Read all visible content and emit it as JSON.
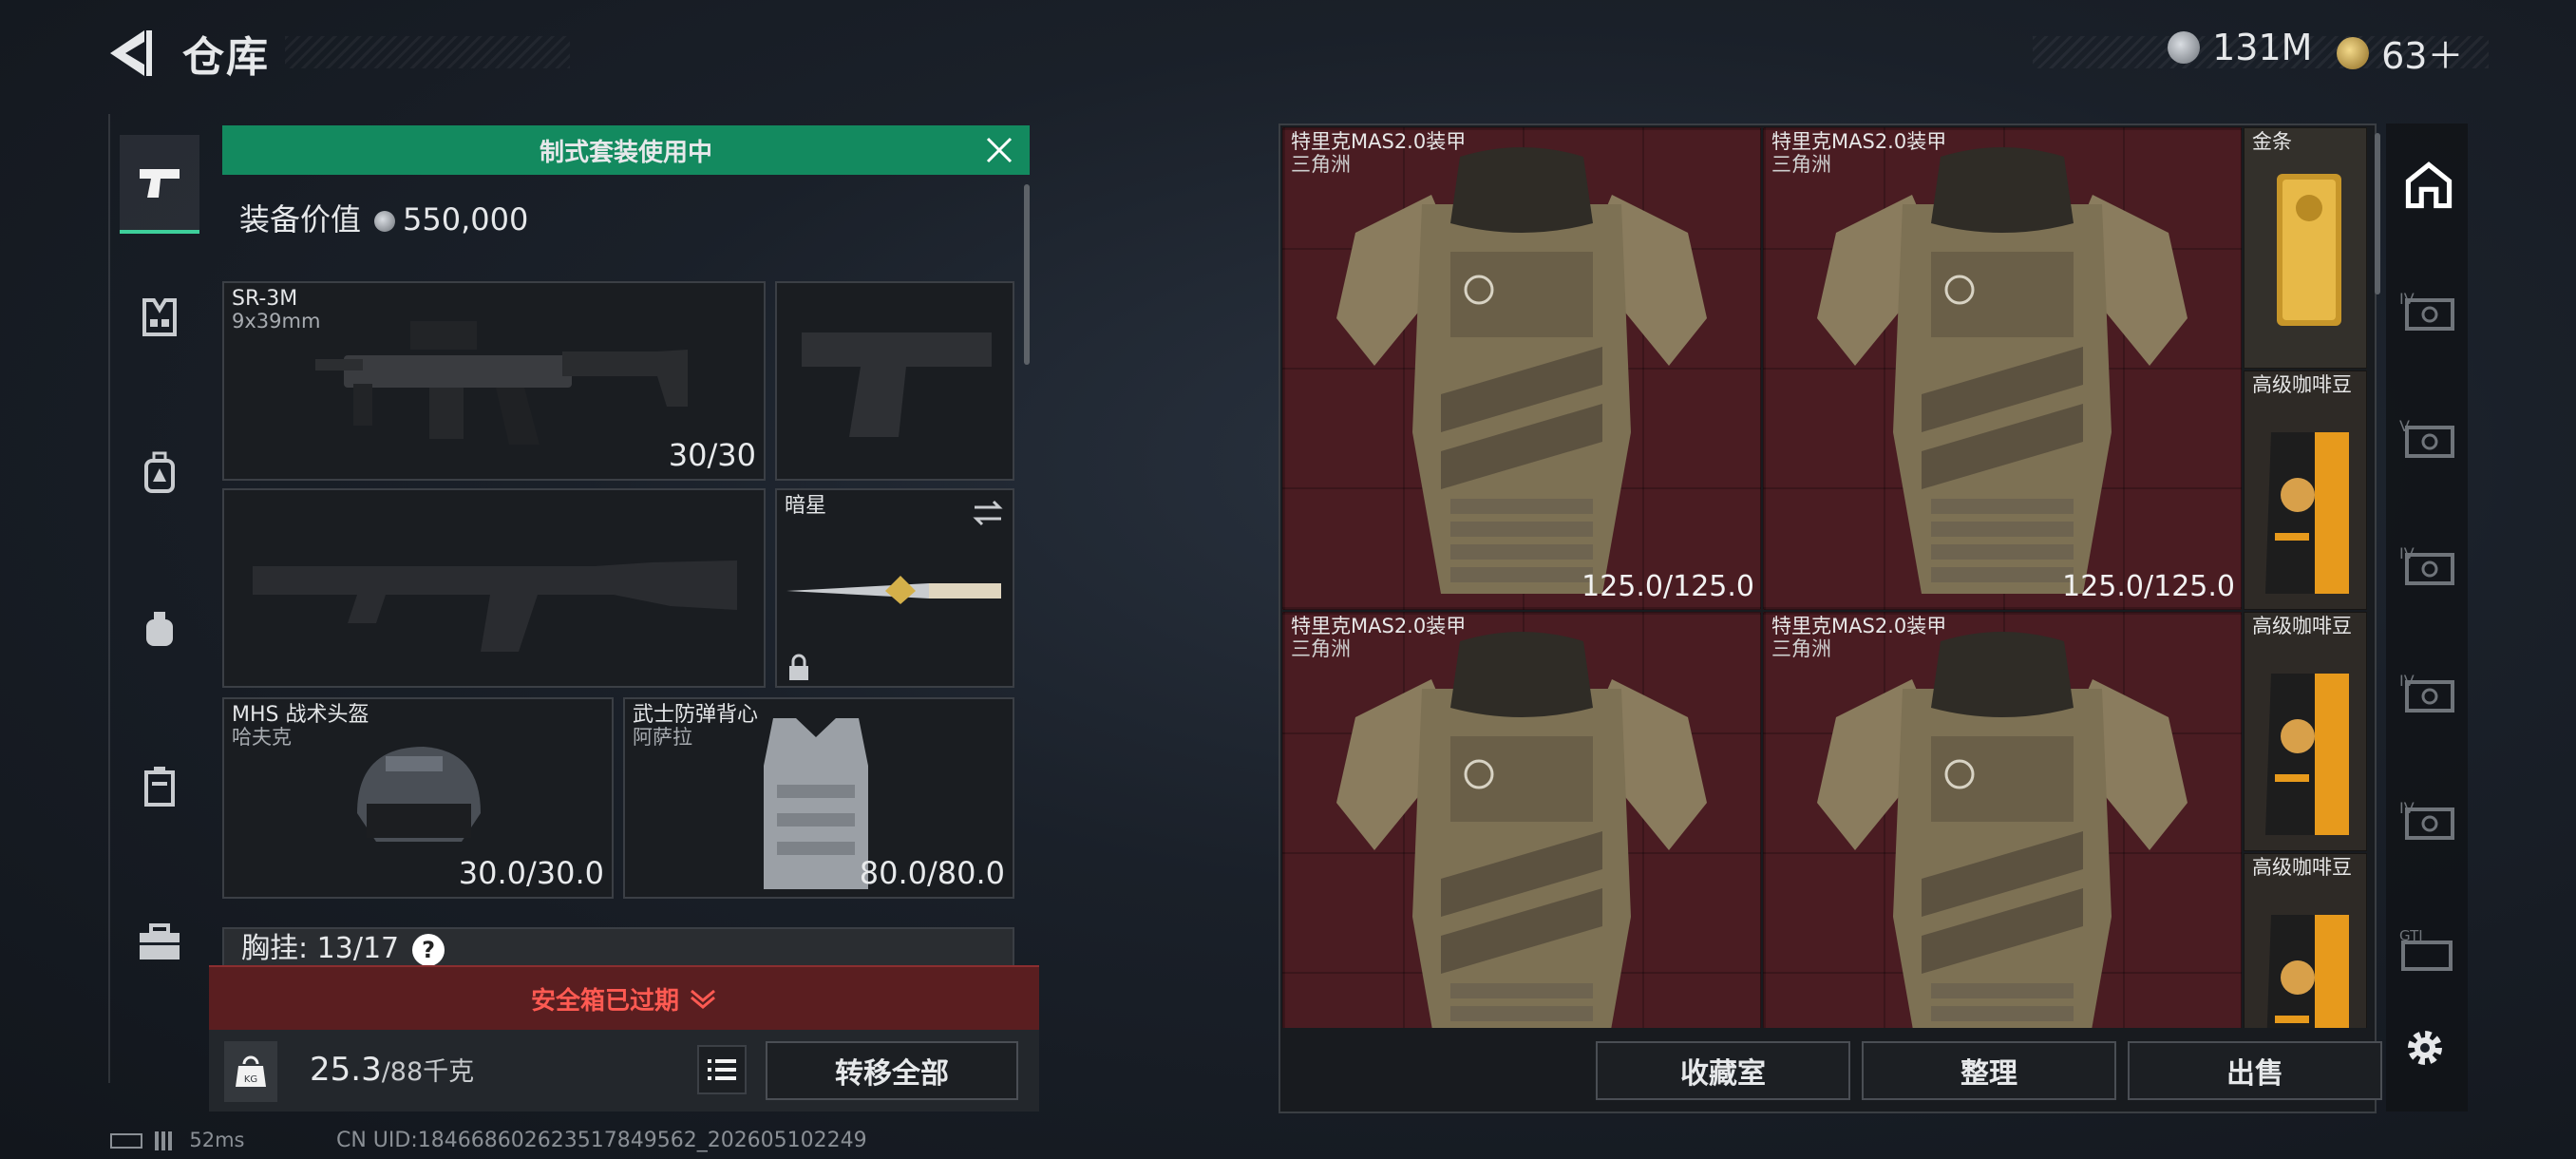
{
  "header": {
    "title": "仓库",
    "currencies": [
      {
        "icon": "silver-coin-icon",
        "value": "131M"
      },
      {
        "icon": "gold-coin-icon",
        "value": "63＋"
      }
    ]
  },
  "loadout": {
    "banner": "制式套装使用中",
    "value_label": "装备价值",
    "value": "550,000",
    "primary": {
      "name": "SR-3M",
      "caliber": "9x39mm",
      "ammo": "30/30"
    },
    "melee": {
      "name": "暗星"
    },
    "helmet": {
      "name": "MHS 战术头盔",
      "sub": "哈夫克",
      "durability": "30.0/30.0"
    },
    "armor": {
      "name": "武士防弹背心",
      "sub": "阿萨拉",
      "durability": "80.0/80.0"
    },
    "chest_rig": {
      "label": "胸挂:",
      "count": "13/17",
      "help": "?"
    },
    "safebox_expired": "安全箱已过期",
    "weight": {
      "value": "25.3",
      "capacity": "/88千克"
    },
    "transfer_all": "转移全部"
  },
  "status": {
    "ping": "52ms",
    "uid": "CN UID:184668602623517849562_202605102249"
  },
  "stash": {
    "items": [
      {
        "name": "特里克MAS2.0装甲",
        "sub": "三角洲",
        "durability": "125.0/125.0"
      },
      {
        "name": "特里克MAS2.0装甲",
        "sub": "三角洲",
        "durability": "125.0/125.0"
      },
      {
        "name": "特里克MAS2.0装甲",
        "sub": "三角洲",
        "durability": ""
      },
      {
        "name": "特里克MAS2.0装甲",
        "sub": "三角洲",
        "durability": ""
      }
    ],
    "side_items": [
      {
        "name": "金条"
      },
      {
        "name": "高级咖啡豆"
      },
      {
        "name": "高级咖啡豆"
      },
      {
        "name": "高级咖啡豆"
      }
    ],
    "buttons": {
      "collection": "收藏室",
      "organize": "整理",
      "sell": "出售"
    }
  },
  "right_rail": {
    "tabs": [
      {
        "icon": "home-stash-icon",
        "label": ""
      },
      {
        "icon": "container-tab-icon",
        "label": "IV"
      },
      {
        "icon": "container-tab-icon",
        "label": "V"
      },
      {
        "icon": "container-tab-icon",
        "label": "IV"
      },
      {
        "icon": "container-tab-icon",
        "label": "IV"
      },
      {
        "icon": "container-tab-icon",
        "label": "IV"
      },
      {
        "icon": "container-tab-icon",
        "label": "GTI"
      }
    ]
  },
  "colors": {
    "accent_green": "#138a5f",
    "expired_red": "#ff5a52",
    "stash_cell": "#4a1c22"
  }
}
